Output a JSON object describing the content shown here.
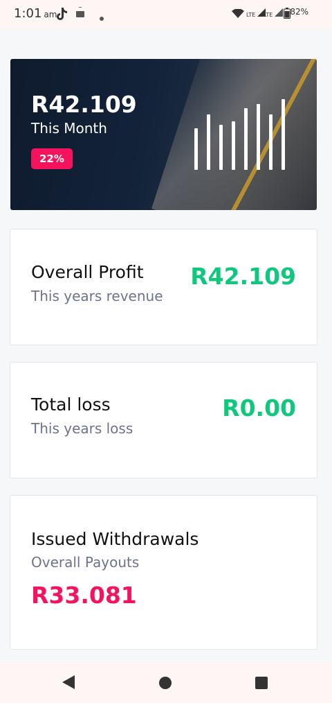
{
  "status_bar": {
    "time": "1:01",
    "ampm": "am",
    "battery": "82%",
    "network_label": "LTE"
  },
  "hero": {
    "amount": "R42.109",
    "label": "This Month",
    "badge": "22%",
    "bar_levels": [
      0.57,
      0.76,
      0.62,
      0.67,
      0.85,
      0.9,
      0.76,
      0.97
    ]
  },
  "cards": {
    "profit": {
      "title": "Overall Profit",
      "subtitle": "This years revenue",
      "value": "R42.109"
    },
    "loss": {
      "title": "Total loss",
      "subtitle": "This years loss",
      "value": "R0.00"
    },
    "withdrawals": {
      "title": "Issued Withdrawals",
      "subtitle": "Overall Payouts",
      "value": "R33.081"
    }
  },
  "colors": {
    "accent_pink": "#f5135d",
    "positive_green": "#10c77e"
  }
}
